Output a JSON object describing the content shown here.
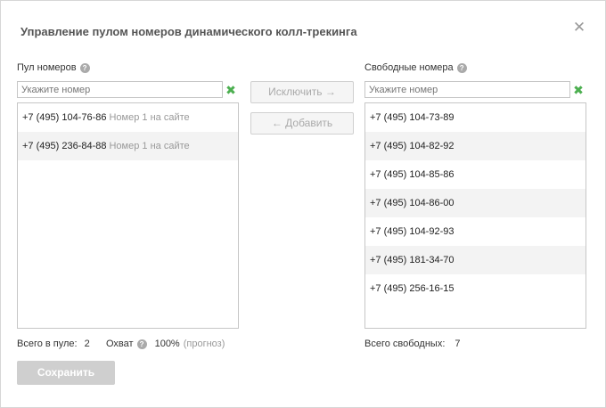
{
  "dialog": {
    "title": "Управление пулом номеров динамического колл-трекинга",
    "close_label": "✕"
  },
  "pool": {
    "label": "Пул номеров",
    "help": "?",
    "search_placeholder": "Укажите номер",
    "clear_label": "✖",
    "items": [
      {
        "number": "+7 (495) 104-76-86",
        "note": "Номер 1 на сайте"
      },
      {
        "number": "+7 (495) 236-84-88",
        "note": "Номер 1 на сайте"
      }
    ],
    "total_label": "Всего в пуле:",
    "total_value": "2",
    "coverage_label": "Охват",
    "coverage_help": "?",
    "coverage_value": "100%",
    "coverage_note": "(прогноз)"
  },
  "actions": {
    "exclude_label": "Исключить →",
    "add_label": "← Добавить"
  },
  "free": {
    "label": "Свободные номера",
    "help": "?",
    "search_placeholder": "Укажите номер",
    "clear_label": "✖",
    "items": [
      {
        "number": "+7 (495) 104-73-89"
      },
      {
        "number": "+7 (495) 104-82-92"
      },
      {
        "number": "+7 (495) 104-85-86"
      },
      {
        "number": "+7 (495) 104-86-00"
      },
      {
        "number": "+7 (495) 104-92-93"
      },
      {
        "number": "+7 (495) 181-34-70"
      },
      {
        "number": "+7 (495) 256-16-15"
      }
    ],
    "total_label": "Всего свободных:",
    "total_value": "7"
  },
  "footer": {
    "save_label": "Сохранить"
  }
}
